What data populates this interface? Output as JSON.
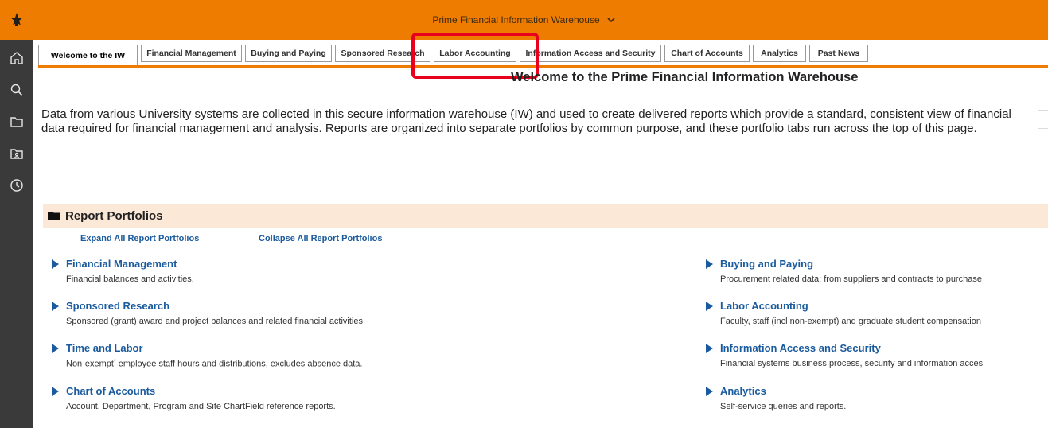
{
  "header": {
    "title": "Prime Financial Information Warehouse"
  },
  "tabs": [
    {
      "label": "Welcome to the IW"
    },
    {
      "label": "Financial Management"
    },
    {
      "label": "Buying and Paying"
    },
    {
      "label": "Sponsored Research"
    },
    {
      "label": "Labor Accounting"
    },
    {
      "label": "Information Access and Security"
    },
    {
      "label": "Chart of Accounts"
    },
    {
      "label": "Analytics"
    },
    {
      "label": "Past News"
    }
  ],
  "main": {
    "heading": "Welcome to the Prime Financial Information Warehouse",
    "intro": "Data from various University systems are collected in this secure information warehouse (IW) and used to create delivered reports which provide a standard, consistent view of financial data required for financial management and analysis. Reports are organized into separate portfolios by common purpose, and these portfolio tabs run across the top of this page."
  },
  "portfolios": {
    "title": "Report Portfolios",
    "expand_label": "Expand All Report Portfolios",
    "collapse_label": "Collapse All Report Portfolios",
    "items": [
      {
        "title": "Financial Management",
        "desc": "Financial balances and activities."
      },
      {
        "title": "Buying and Paying",
        "desc": "Procurement related data; from suppliers and contracts to purchase"
      },
      {
        "title": "Sponsored Research",
        "desc": "Sponsored (grant) award and project balances and related financial activities."
      },
      {
        "title": "Labor Accounting",
        "desc": "Faculty, staff (incl non-exempt) and graduate student compensation"
      },
      {
        "title": "Time and Labor",
        "desc_a": "Non-exempt",
        "desc_sup": "*",
        "desc_b": " employee staff hours and distributions, excludes absence data."
      },
      {
        "title": "Information Access and Security",
        "desc": "Financial systems business process, security and information acces"
      },
      {
        "title": "Chart of Accounts",
        "desc": "Account, Department, Program and Site ChartField reference reports."
      },
      {
        "title": "Analytics",
        "desc": "Self-service queries and reports."
      }
    ]
  },
  "colors": {
    "brand_orange": "#ee7c00",
    "sidebar": "#3a3a3a",
    "link_blue": "#1a5b9e",
    "highlight_red": "#e8001c",
    "section_bg": "#fbe8d6"
  },
  "icons": {
    "logo": "star-logo-icon",
    "home": "home-icon",
    "search": "search-icon",
    "folder": "folder-icon",
    "shared": "shared-folder-icon",
    "recent": "clock-icon"
  }
}
